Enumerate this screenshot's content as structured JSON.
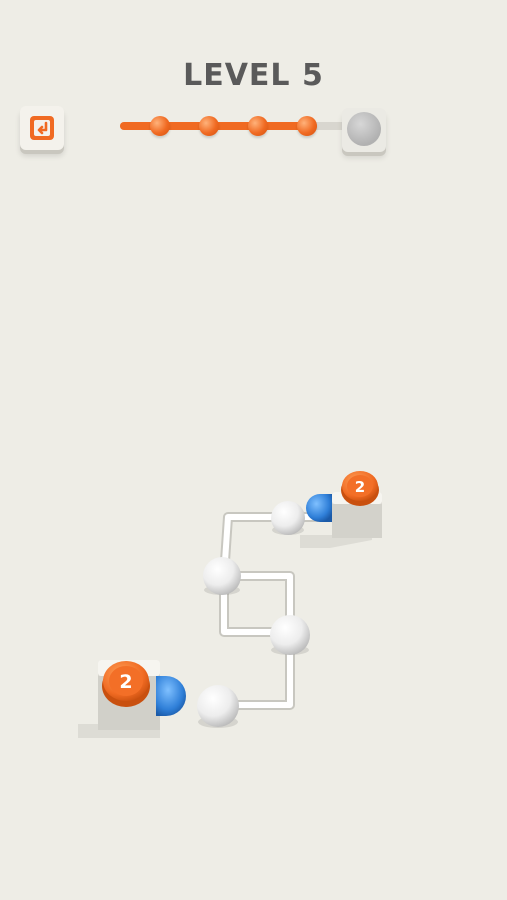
{
  "level": {
    "title": "LEVEL 5"
  },
  "progress": {
    "completed_steps": 4,
    "total_steps": 5
  },
  "colors": {
    "background": "#eeede6",
    "accent_orange": "#f06a22",
    "connector_blue": "#2f7fd8",
    "pipe": "#ffffff"
  },
  "buttons": {
    "restart_icon": "restart-icon"
  },
  "nodes": {
    "socket_top": {
      "number": "2"
    },
    "socket_bottom": {
      "number": "2"
    }
  }
}
